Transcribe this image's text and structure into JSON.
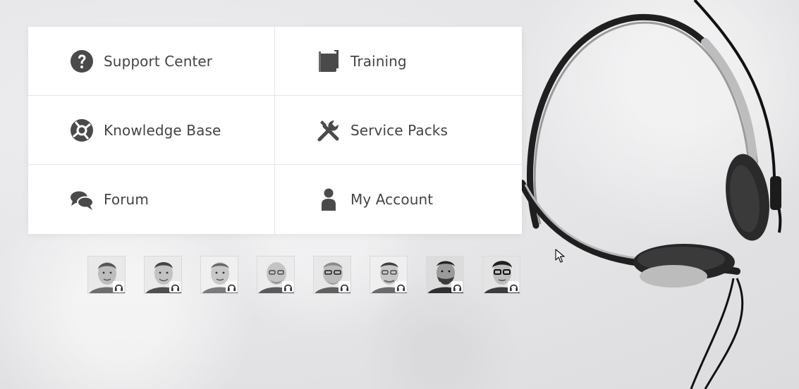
{
  "menu": {
    "items": [
      {
        "label": "Support Center",
        "icon": "question-circle-icon"
      },
      {
        "label": "Training",
        "icon": "book-icon"
      },
      {
        "label": "Knowledge Base",
        "icon": "lifebuoy-icon"
      },
      {
        "label": "Service Packs",
        "icon": "tools-icon"
      },
      {
        "label": "Forum",
        "icon": "chat-bubbles-icon"
      },
      {
        "label": "My Account",
        "icon": "user-icon"
      }
    ]
  },
  "team": {
    "avatars": [
      {
        "icon": "support-agent-avatar"
      },
      {
        "icon": "support-agent-avatar"
      },
      {
        "icon": "support-agent-avatar"
      },
      {
        "icon": "support-agent-avatar"
      },
      {
        "icon": "support-agent-avatar"
      },
      {
        "icon": "support-agent-avatar"
      },
      {
        "icon": "support-agent-avatar"
      },
      {
        "icon": "support-agent-avatar"
      }
    ],
    "badge_icon": "headset-icon"
  },
  "colors": {
    "icon": "#4a4a4a",
    "text": "#444444",
    "panel": "#ffffff"
  }
}
